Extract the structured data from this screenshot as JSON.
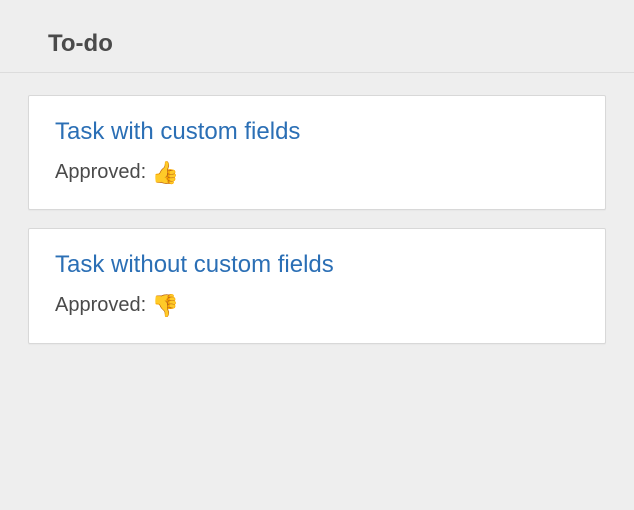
{
  "section": {
    "title": "To-do"
  },
  "cards": [
    {
      "title": "Task with custom fields",
      "field_label": "Approved:",
      "field_value": "👍"
    },
    {
      "title": "Task without custom fields",
      "field_label": "Approved:",
      "field_value": "👎"
    }
  ]
}
